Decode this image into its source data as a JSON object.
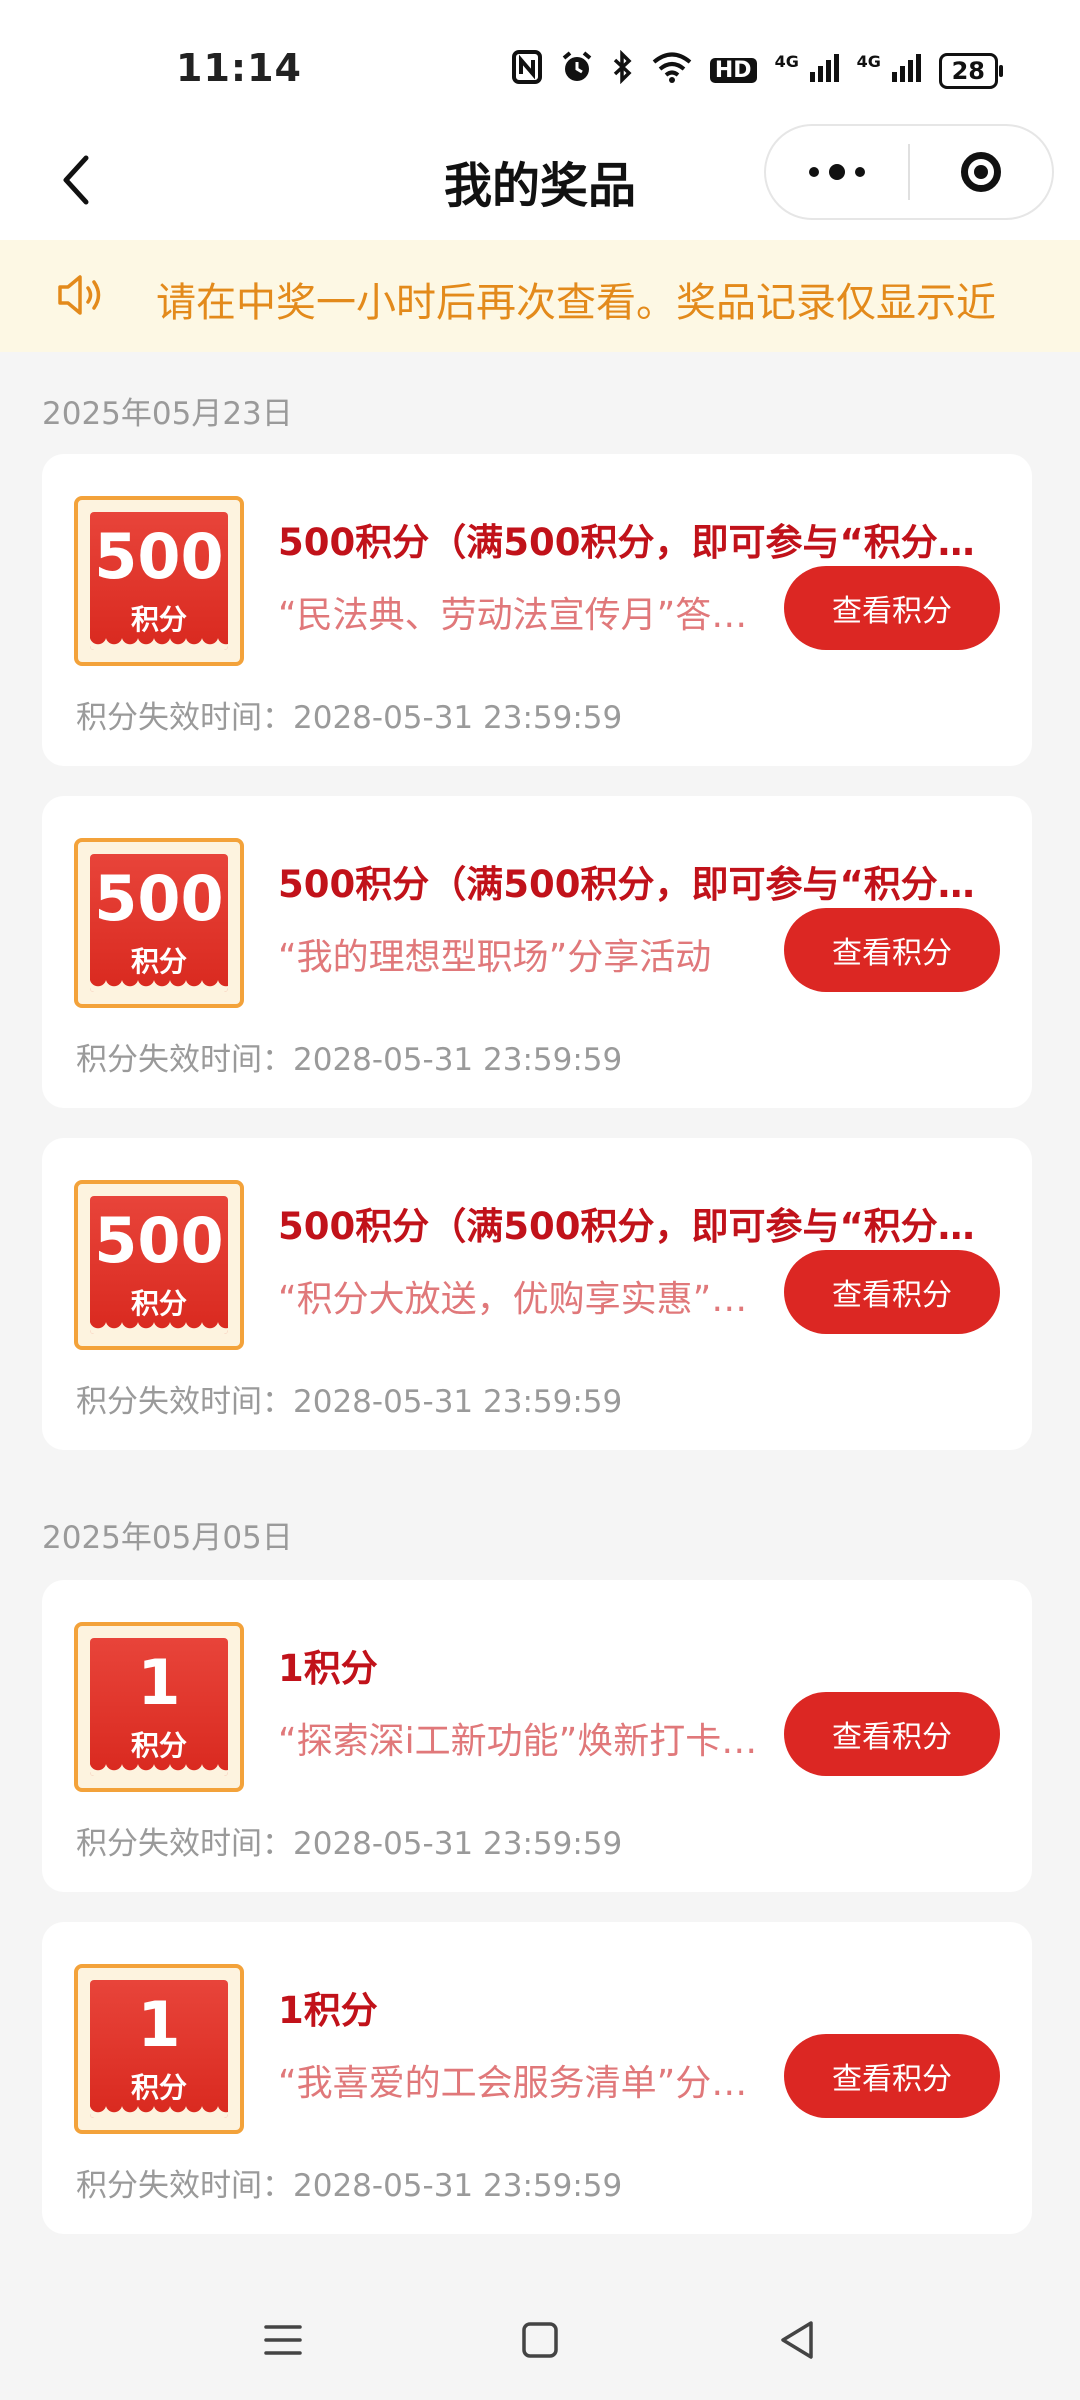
{
  "status_bar": {
    "time": "11:14",
    "icons": [
      "nfc-icon",
      "alarm-icon",
      "bluetooth-icon",
      "wifi-icon",
      "hd-icon",
      "4g-signal-icon",
      "4g-signal-icon"
    ],
    "hd_label": "HD",
    "net1": "4G",
    "net2": "4G",
    "battery": "28"
  },
  "nav": {
    "title": "我的奖品"
  },
  "notice": {
    "text": "请在中奖一小时后再次查看。奖品记录仅显示近"
  },
  "colors": {
    "accent_red": "#dc2723",
    "title_red": "#c1121a",
    "notice_orange": "#e38a1b",
    "badge_border": "#f3a23a"
  },
  "groups": [
    {
      "date": "2025年05月23日",
      "items": [
        {
          "badge_value": "500",
          "badge_unit": "积分",
          "title": "500积分（满500积分，即可参与“积分…",
          "desc": "“民法典、劳动法宣传月”答…",
          "button": "查看积分",
          "expiry": "积分失效时间：2028-05-31 23:59:59"
        },
        {
          "badge_value": "500",
          "badge_unit": "积分",
          "title": "500积分（满500积分，即可参与“积分…",
          "desc": "“我的理想型职场”分享活动",
          "button": "查看积分",
          "expiry": "积分失效时间：2028-05-31 23:59:59"
        },
        {
          "badge_value": "500",
          "badge_unit": "积分",
          "title": "500积分（满500积分，即可参与“积分…",
          "desc": "“积分大放送，优购享实惠”…",
          "button": "查看积分",
          "expiry": "积分失效时间：2028-05-31 23:59:59"
        }
      ]
    },
    {
      "date": "2025年05月05日",
      "items": [
        {
          "badge_value": "1",
          "badge_unit": "积分",
          "title": "1积分",
          "desc": "“探索深i工新功能”焕新打卡…",
          "button": "查看积分",
          "expiry": "积分失效时间：2028-05-31 23:59:59"
        },
        {
          "badge_value": "1",
          "badge_unit": "积分",
          "title": "1积分",
          "desc": "“我喜爱的工会服务清单”分…",
          "button": "查看积分",
          "expiry": "积分失效时间：2028-05-31 23:59:59"
        }
      ]
    }
  ]
}
